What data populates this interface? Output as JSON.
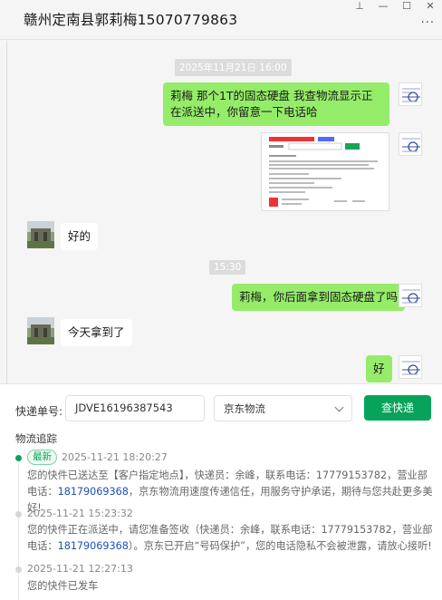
{
  "window": {
    "title": "赣州定南县郭莉梅15070779863",
    "pin_glyph": "⊥",
    "min_glyph": "—",
    "max_glyph": "☐",
    "close_glyph": "✕",
    "more_glyph": "···"
  },
  "chat": {
    "timestamp_1": "2025年11月21日 16:00",
    "msg_1": "莉梅 那个1T的固态硬盘 我查物流显示正在派送中，你留意一下电话哈",
    "msg_2": "好的",
    "timestamp_2": "15:30",
    "msg_3": "莉梅，你后面拿到固态硬盘了吗",
    "msg_4": "今天拿到了",
    "msg_5": "好"
  },
  "tracking": {
    "label": "快递单号:",
    "number": "JDVE16196387543",
    "carrier": "京东物流",
    "query_button": "查快递",
    "section_title": "物流追踪",
    "badge_new": "最新",
    "events": [
      {
        "time": "2025-11-21 18:20:27",
        "text_a": "您的快件已送达至【客户指定地点】，快递员：余峰，联系电话：17779153782，营业部电话：",
        "phone": "18179069368",
        "text_b": "，京东物流用速度传递信任，用服务守护承诺，期待与您共赴更多美好!"
      },
      {
        "time": "2025-11-21 15:23:32",
        "text_a": "您的快件正在派送中，请您准备签收（快递员：余峰，联系电话：17779153782，营业部电话：",
        "phone": "18179069368",
        "text_b": "）。京东已开启“号码保护”，您的电话隐私不会被泄露，请放心接听!"
      },
      {
        "time": "2025-11-21 12:27:13",
        "text_a": "您的快件已发车",
        "phone": "",
        "text_b": ""
      }
    ]
  },
  "colors": {
    "accent_green": "#07a35a",
    "bubble_me": "#95ec69",
    "phone_link": "#1f4fb5"
  }
}
